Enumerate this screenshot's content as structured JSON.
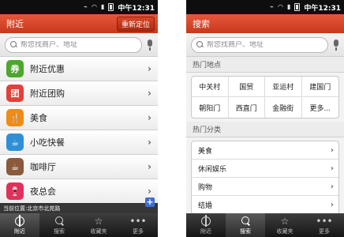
{
  "status_bar": {
    "time": "中午12:31"
  },
  "left": {
    "title": "附近",
    "relocate_label": "重新定位",
    "search_placeholder": "帮您找商户、地址",
    "menu": [
      {
        "label": "附近优惠",
        "icon_text": "券",
        "icon": "coupon-icon",
        "color": "#4ea62f"
      },
      {
        "label": "附近团购",
        "icon_text": "团",
        "icon": "group-buy-icon",
        "color": "#e2413a"
      },
      {
        "label": "美食",
        "icon_text": "🍴",
        "icon": "fork-knife-icon",
        "color": "#ef8b17"
      },
      {
        "label": "小吃快餐",
        "icon_text": "☕",
        "icon": "snack-cup-icon",
        "color": "#2f8fd6"
      },
      {
        "label": "咖啡厅",
        "icon_text": "☕",
        "icon": "coffee-icon",
        "color": "#8a5a3b"
      },
      {
        "label": "夜总会",
        "icon_text": "🍷",
        "icon": "nightclub-icon",
        "color": "#e0305c"
      }
    ],
    "location_text": "当前位置:北京市北苑路"
  },
  "right": {
    "title": "搜索",
    "search_placeholder": "帮您找商户、地址",
    "hot_places_header": "热门地点",
    "hot_places": [
      "中关村",
      "国贸",
      "亚运村",
      "建国门",
      "朝阳门",
      "西直门",
      "金融街",
      "更多..."
    ],
    "hot_categories_header": "热门分类",
    "categories": [
      "美食",
      "休闲娱乐",
      "购物",
      "结婚"
    ]
  },
  "tabs": [
    {
      "label": "附近",
      "icon": "crosshair-icon"
    },
    {
      "label": "搜索",
      "icon": "search-icon"
    },
    {
      "label": "收藏夹",
      "icon": "star-icon"
    },
    {
      "label": "更多",
      "icon": "more-dots-icon"
    }
  ],
  "colors": {
    "accent": "#d9462b",
    "tabbar": "#222222"
  }
}
